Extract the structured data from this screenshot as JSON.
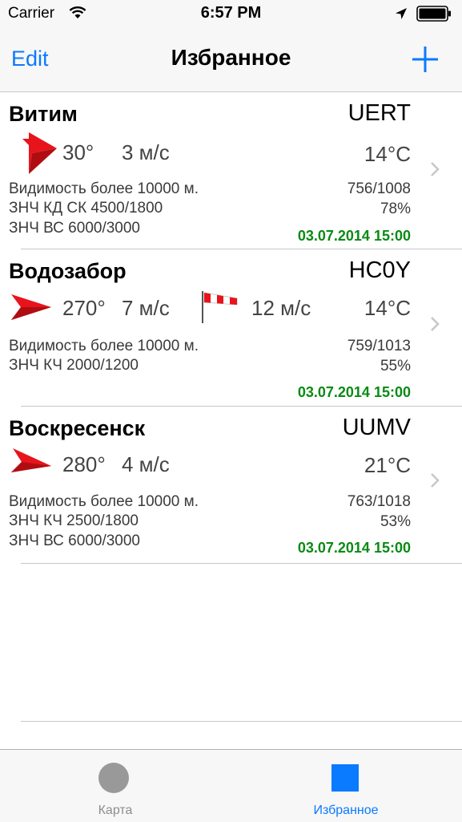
{
  "status_bar": {
    "carrier": "Carrier",
    "time": "6:57 PM"
  },
  "nav": {
    "edit_label": "Edit",
    "title": "Избранное",
    "add_icon": "plus-icon"
  },
  "stations": [
    {
      "name": "Витим",
      "code": "UERT",
      "direction": "30°",
      "speed": "3 м/с",
      "temperature": "14°C",
      "left_lines": [
        "Видимость более 10000 м.",
        "ЗНЧ КД СК 4500/1800",
        "ЗНЧ ВС 6000/3000"
      ],
      "pressure": "756/1008",
      "humidity": "78%",
      "date": "03.07.2014 15:00"
    },
    {
      "name": "Водозабор",
      "code": "HC0Y",
      "direction": "270°",
      "speed": "7 м/с",
      "gust": "12 м/с",
      "temperature": "14°C",
      "left_lines": [
        "Видимость более 10000 м.",
        "ЗНЧ КЧ 2000/1200"
      ],
      "pressure": "759/1013",
      "humidity": "55%",
      "date": "03.07.2014 15:00"
    },
    {
      "name": "Воскресенск",
      "code": "UUMV",
      "direction": "280°",
      "speed": "4 м/с",
      "temperature": "21°C",
      "left_lines": [
        "Видимость более 10000 м.",
        "ЗНЧ КЧ 2500/1800",
        "ЗНЧ ВС 6000/3000"
      ],
      "pressure": "763/1018",
      "humidity": "53%",
      "date": "03.07.2014 15:00"
    }
  ],
  "tabs": [
    {
      "label": "Карта",
      "icon": "map-tab-icon",
      "selected": false
    },
    {
      "label": "Избранное",
      "icon": "favorites-tab-icon",
      "selected": true
    }
  ],
  "colors": {
    "accent": "#0a7aff",
    "date_green": "#0a8a14",
    "wind_red": "#e8141b"
  }
}
